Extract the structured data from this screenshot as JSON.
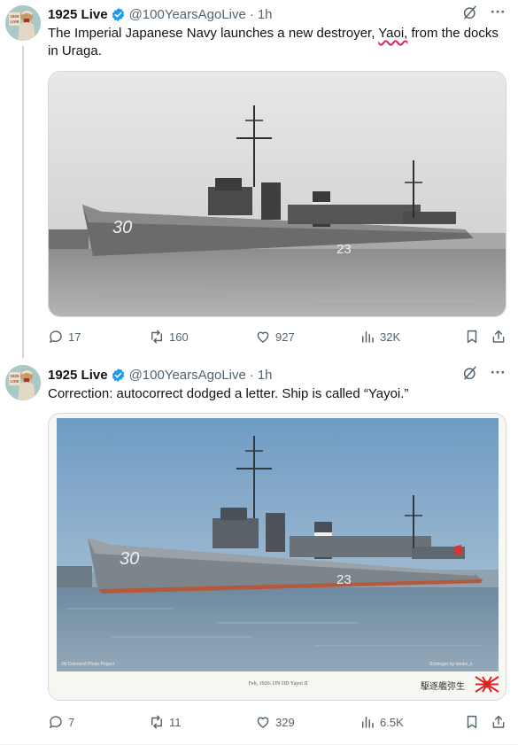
{
  "tweets": [
    {
      "author": {
        "name": "1925 Live",
        "handle": "@100YearsAgoLive",
        "time": "1h",
        "avatar_text": "1925 LIVE"
      },
      "text": {
        "before": "The Imperial Japanese Navy launches a new destroyer, ",
        "misspelled": "Yaoi,",
        "after": " from the docks in Uraga."
      },
      "image": {
        "hull_number": "30",
        "funnel_number": "23"
      },
      "stats": {
        "replies": "17",
        "reposts": "160",
        "likes": "927",
        "views": "32K"
      }
    },
    {
      "author": {
        "name": "1925 Live",
        "handle": "@100YearsAgoLive",
        "time": "1h",
        "avatar_text": "1925 LIVE"
      },
      "text": {
        "before": "Correction: autocorrect dodged a letter. Ship is called “Yayoi.”",
        "misspelled": "",
        "after": ""
      },
      "image": {
        "hull_number": "30",
        "funnel_number": "23",
        "caption": "Feb, 1926: IJN DD Yayoi II",
        "watermark_left": "JN Colorized Photo Project",
        "watermark_right": "Schrieger by tambo_k",
        "japanese_label": "駆逐艦弥生"
      },
      "stats": {
        "replies": "7",
        "reposts": "11",
        "likes": "329",
        "views": "6.5K"
      }
    }
  ],
  "colors": {
    "verified": "#1d9bf0",
    "misspelling_underline": "#e0245e",
    "meta_gray": "#536471",
    "divider": "#eff3f4"
  },
  "icons": [
    "verified-badge-icon",
    "grok-icon",
    "more-icon",
    "reply-icon",
    "retweet-icon",
    "like-icon",
    "views-icon",
    "bookmark-icon",
    "share-icon"
  ]
}
